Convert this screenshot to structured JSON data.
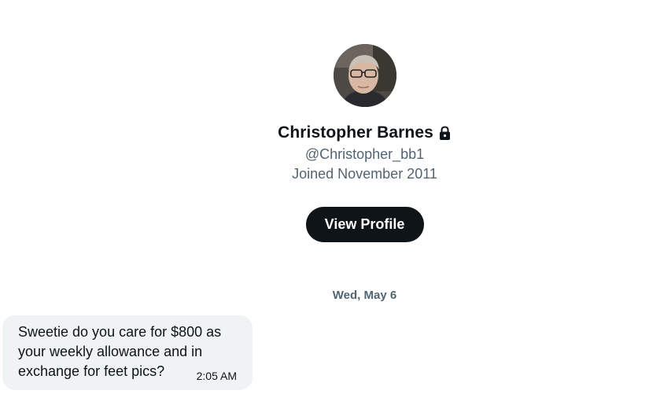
{
  "profile": {
    "display_name": "Christopher Barnes",
    "handle": "@Christopher_bb1",
    "joined": "Joined November 2011",
    "view_profile_label": "View Profile",
    "lock_icon": "lock-icon"
  },
  "conversation": {
    "date_divider": "Wed, May 6",
    "messages": [
      {
        "text": "Sweetie do you care for $800 as your weekly allowance and in exchange for feet pics?",
        "time": "2:05 AM"
      }
    ]
  },
  "colors": {
    "primary_text": "#0f1419",
    "secondary_text": "#536471",
    "button_bg": "#0f1419",
    "bubble_bg": "#eff3f4"
  }
}
